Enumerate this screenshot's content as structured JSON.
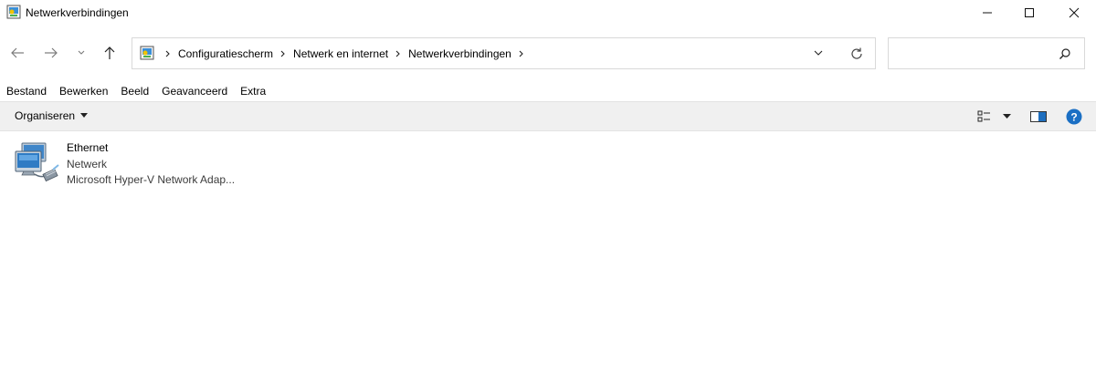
{
  "window": {
    "title": "Netwerkverbindingen",
    "controls": [
      "minimize-icon",
      "maximize-icon",
      "close-icon"
    ]
  },
  "navigation": {
    "buttons": [
      "back-arrow-icon",
      "forward-arrow-icon",
      "recent-dropdown-icon",
      "up-arrow-icon"
    ]
  },
  "address": {
    "icon": "control-panel-icon",
    "crumbs": [
      "Configuratiescherm",
      "Netwerk en internet",
      "Netwerkverbindingen"
    ]
  },
  "search": {
    "value": "",
    "placeholder": ""
  },
  "menu": {
    "items": [
      "Bestand",
      "Bewerken",
      "Beeld",
      "Geavanceerd",
      "Extra"
    ]
  },
  "commandbar": {
    "organize_label": "Organiseren"
  },
  "connections": [
    {
      "name": "Ethernet",
      "status": "Netwerk",
      "device": "Microsoft Hyper-V Network Adap...",
      "icon": "network-adapter-icon"
    }
  ],
  "colors": {
    "commandbar_bg": "#f0f0f0",
    "help_blue": "#1a6fc4",
    "border": "#d9d9d9"
  }
}
